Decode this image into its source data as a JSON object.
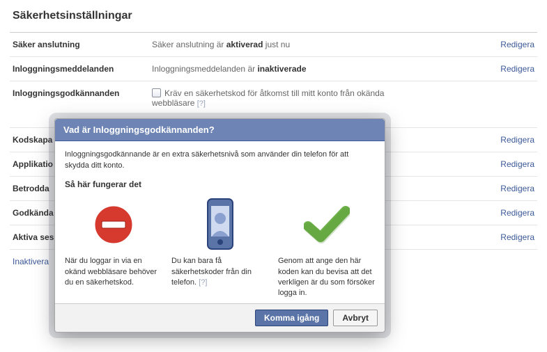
{
  "page_title": "Säkerhetsinställningar",
  "edit_label": "Redigera",
  "rows": {
    "secure": {
      "label": "Säker anslutning",
      "desc_pre": "Säker anslutning är ",
      "desc_bold": "aktiverad",
      "desc_post": " just nu"
    },
    "login_notif": {
      "label": "Inloggningsmeddelanden",
      "desc_pre": "Inloggningsmeddelanden är ",
      "desc_bold": "inaktiverade",
      "desc_post": ""
    },
    "approvals": {
      "label": "Inloggningsgodkännanden",
      "checkbox_text": "Kräv en säkerhetskod för åtkomst till mitt konto från okända webbläsare",
      "help": "[?]"
    },
    "codegen": {
      "label": "Kodskapa"
    },
    "apps": {
      "label": "Applikatio"
    },
    "trusted": {
      "label": "Betrodda "
    },
    "approved": {
      "label": "Godkända"
    },
    "active": {
      "label": "Aktiva ses"
    }
  },
  "deactivate": "Inaktivera ",
  "modal": {
    "title": "Vad är Inloggningsgodkännanden?",
    "intro": "Inloggningsgodkännande är en extra säkerhetsnivå som använder din telefon för att skydda ditt konto.",
    "how": "Så här fungerar det",
    "step1": "När du loggar in via en okänd webbläsare behöver du en säkerhetskod.",
    "step2": "Du kan bara få säkerhetskoder från din telefon.",
    "step2_help": "[?]",
    "step3": "Genom att ange den här koden kan du bevisa att det verkligen är du som försöker logga in.",
    "start": "Komma igång",
    "cancel": "Avbryt"
  },
  "colors": {
    "link": "#3b5998",
    "header": "#6d84b4"
  }
}
